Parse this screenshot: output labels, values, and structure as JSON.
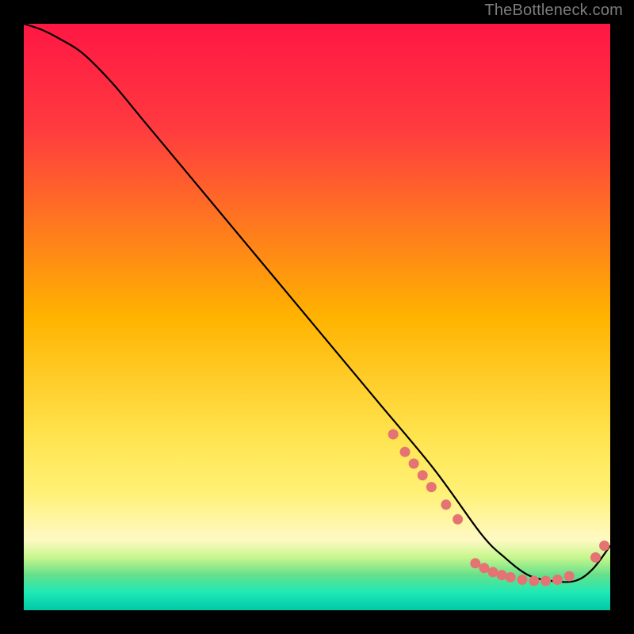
{
  "attribution": "TheBottleneck.com",
  "chart_data": {
    "type": "line",
    "title": "",
    "xlabel": "",
    "ylabel": "",
    "xlim": [
      0,
      100
    ],
    "ylim": [
      0,
      100
    ],
    "background_gradient_stops": [
      {
        "offset": 0,
        "color": "#ff1744"
      },
      {
        "offset": 0.18,
        "color": "#ff3b3f"
      },
      {
        "offset": 0.5,
        "color": "#ffb300"
      },
      {
        "offset": 0.7,
        "color": "#ffe34d"
      },
      {
        "offset": 0.8,
        "color": "#fff176"
      },
      {
        "offset": 0.88,
        "color": "#fff9c4"
      },
      {
        "offset": 0.91,
        "color": "#c6f68d"
      },
      {
        "offset": 0.94,
        "color": "#66e08b"
      },
      {
        "offset": 0.97,
        "color": "#1de9b6"
      },
      {
        "offset": 1.0,
        "color": "#00c9a7"
      }
    ],
    "series": [
      {
        "name": "bottleneck-curve",
        "x": [
          0,
          3,
          6,
          10,
          15,
          20,
          30,
          40,
          50,
          60,
          70,
          78,
          82,
          86,
          90,
          94,
          97,
          100
        ],
        "y": [
          100,
          99,
          97.5,
          95,
          90,
          84,
          72,
          60,
          48,
          36,
          24,
          13,
          9,
          6,
          5,
          5,
          7,
          11
        ]
      }
    ],
    "markers": [
      {
        "x": 63,
        "y": 30
      },
      {
        "x": 65,
        "y": 27
      },
      {
        "x": 66.5,
        "y": 25
      },
      {
        "x": 68,
        "y": 23
      },
      {
        "x": 69.5,
        "y": 21
      },
      {
        "x": 72,
        "y": 18
      },
      {
        "x": 74,
        "y": 15.5
      },
      {
        "x": 77,
        "y": 8
      },
      {
        "x": 78.5,
        "y": 7.2
      },
      {
        "x": 80,
        "y": 6.5
      },
      {
        "x": 81.5,
        "y": 6
      },
      {
        "x": 83,
        "y": 5.6
      },
      {
        "x": 85,
        "y": 5.2
      },
      {
        "x": 87,
        "y": 5
      },
      {
        "x": 89,
        "y": 5
      },
      {
        "x": 91,
        "y": 5.2
      },
      {
        "x": 93,
        "y": 5.8
      },
      {
        "x": 97.5,
        "y": 9
      },
      {
        "x": 99,
        "y": 11
      }
    ],
    "marker_color": "#e57373",
    "curve_color": "#000000"
  }
}
